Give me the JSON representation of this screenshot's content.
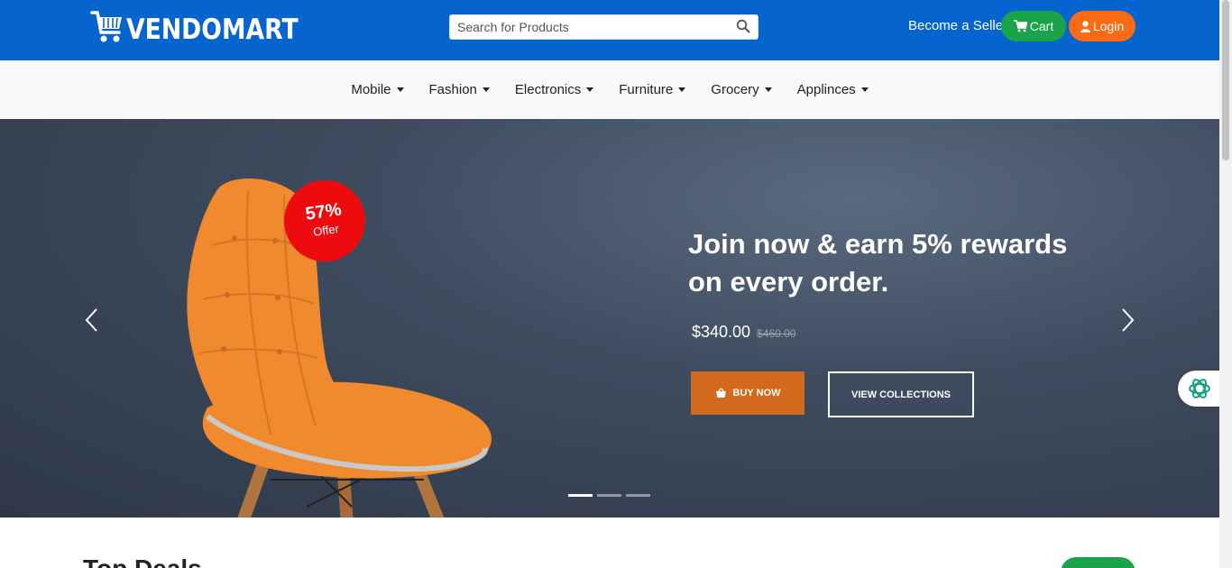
{
  "header": {
    "logo_text": "VENDOMART",
    "search_placeholder": "Search for Products",
    "become_seller": "Become a Seller",
    "cart_label": "Cart",
    "login_label": "Login"
  },
  "categories": [
    {
      "label": "Mobile"
    },
    {
      "label": "Fashion"
    },
    {
      "label": "Electronics"
    },
    {
      "label": "Furniture"
    },
    {
      "label": "Grocery"
    },
    {
      "label": "Applinces"
    }
  ],
  "hero": {
    "offer_percent": "57%",
    "offer_label": "Offer",
    "headline": "Join now & earn 5% rewards on every order.",
    "price": "$340.00",
    "old_price": "$460.00",
    "buy_now": "BUY NOW",
    "view_collections": "VIEW COLLECTIONS",
    "slide_count": 3,
    "active_slide": 1
  },
  "section": {
    "title": "Top Deals"
  },
  "colors": {
    "header_bg": "#0664cf",
    "cart_bg": "#1aa34a",
    "login_bg": "#fb6b14",
    "offer_bg": "#ee0b10",
    "buy_bg": "#d2691e"
  }
}
